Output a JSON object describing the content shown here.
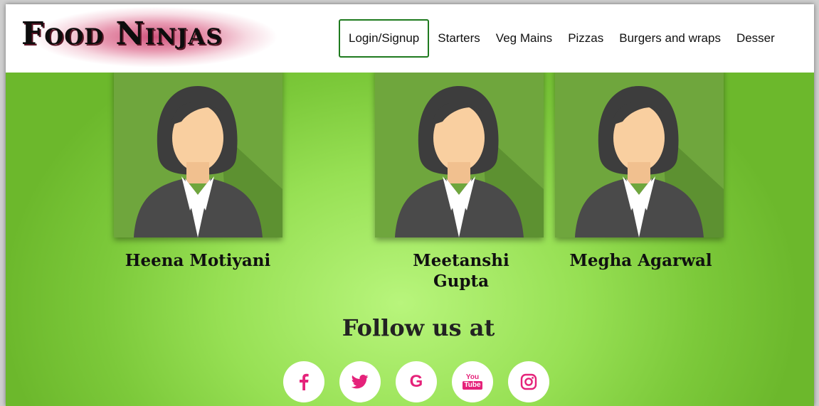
{
  "brand": {
    "logo_text": "Food Ninjas"
  },
  "nav": {
    "login": "Login/Signup",
    "items": [
      "Starters",
      "Veg Mains",
      "Pizzas",
      "Burgers and wraps",
      "Desser"
    ]
  },
  "team": [
    {
      "name": "Heena Motiyani"
    },
    {
      "name": "Meetanshi\nGupta"
    },
    {
      "name": "Megha Agarwal"
    }
  ],
  "follow": {
    "heading": "Follow us at",
    "icons": [
      "facebook-icon",
      "twitter-icon",
      "google-icon",
      "youtube-icon",
      "instagram-icon"
    ],
    "youtube_top": "You",
    "youtube_bottom": "Tube"
  },
  "colors": {
    "accent_pink": "#e5227a",
    "nav_border": "#1f7a1f",
    "background_green": "#97e054"
  }
}
